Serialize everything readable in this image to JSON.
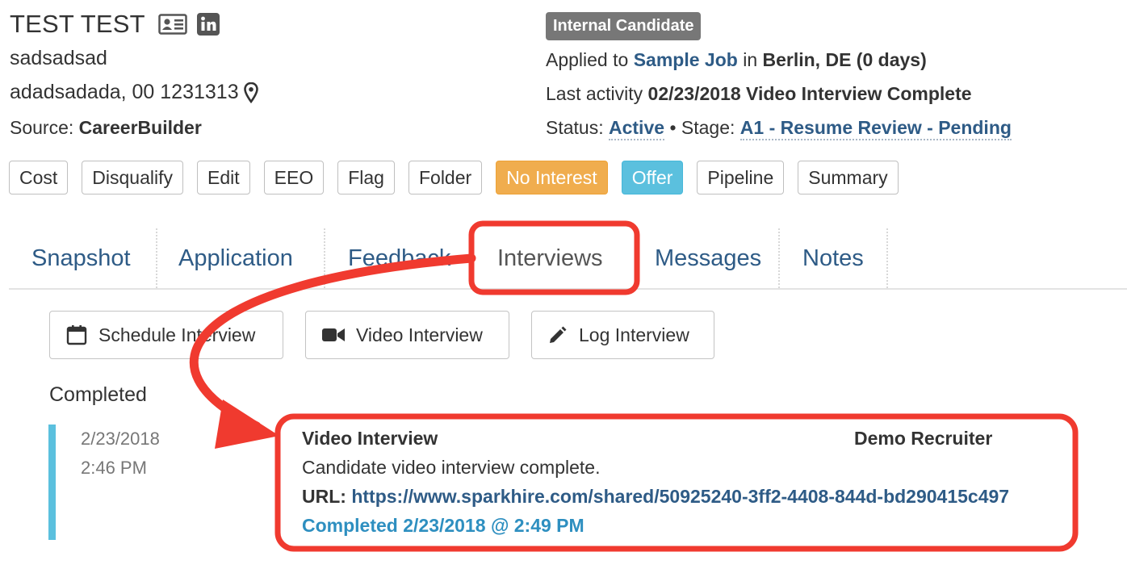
{
  "candidate": {
    "name": "TEST TEST",
    "line1": "sadsadsad",
    "line2": "adadsadada, 00 1231313",
    "source_label": "Source:",
    "source_value": "CareerBuilder"
  },
  "header_icons": [
    "contact-card-icon",
    "linkedin-icon",
    "map-marker-icon"
  ],
  "badge": "Internal Candidate",
  "applied": {
    "prefix": "Applied to",
    "job": "Sample Job",
    "in": "in",
    "location": "Berlin, DE (0 days)"
  },
  "activity": {
    "prefix": "Last activity",
    "value": "02/23/2018 Video Interview Complete"
  },
  "status": {
    "status_label": "Status:",
    "status_value": "Active",
    "separator": "•",
    "stage_label": "Stage:",
    "stage_value": "A1 - Resume Review - Pending"
  },
  "actions": {
    "cost": "Cost",
    "disqualify": "Disqualify",
    "edit": "Edit",
    "eeo": "EEO",
    "flag": "Flag",
    "folder": "Folder",
    "no_interest": "No Interest",
    "offer": "Offer",
    "pipeline": "Pipeline",
    "summary": "Summary"
  },
  "tabs": {
    "snapshot": "Snapshot",
    "application": "Application",
    "feedback": "Feedback",
    "interviews": "Interviews",
    "messages": "Messages",
    "notes": "Notes",
    "active": "Interviews"
  },
  "interview_buttons": {
    "schedule": "Schedule Interview",
    "video": "Video Interview",
    "log": "Log Interview"
  },
  "completed": {
    "title": "Completed",
    "date": "2/23/2018",
    "time": "2:46 PM",
    "entry_title": "Video Interview",
    "entry_user": "Demo Recruiter",
    "entry_desc": "Candidate video interview complete.",
    "url_label": "URL:",
    "url": "https://www.sparkhire.com/shared/50925240-3ff2-4408-844d-bd290415c497",
    "completed_text": "Completed 2/23/2018 @ 2:49 PM"
  },
  "colors": {
    "link": "#2e5b86",
    "accent_blue": "#5bc0de",
    "warning": "#f0ad4e",
    "badge": "#777777",
    "annotation": "#f03a2f"
  }
}
